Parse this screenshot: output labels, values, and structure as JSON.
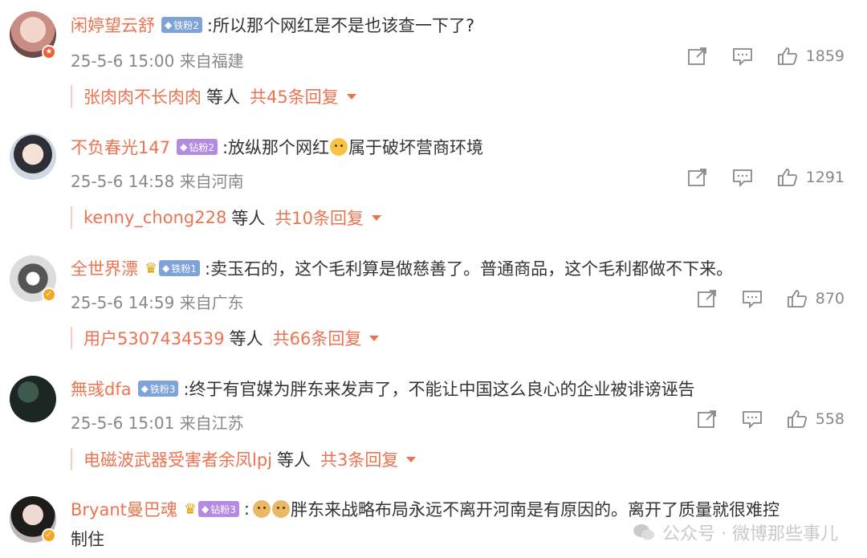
{
  "comments": [
    {
      "username": "闲婷望云舒",
      "badge": "铁粉2",
      "badge_color": "#7fa3d9",
      "text": ":所以那个网红是不是也该查一下了?",
      "text2": "",
      "time": "25-5-6 15:00",
      "location": "来自福建",
      "likes": "1859",
      "reply_user": "张肉肉不长肉肉",
      "reply_etc": "等人",
      "reply_count": "共45条回复"
    },
    {
      "username": "不负春光147",
      "badge": "钻粉2",
      "badge_color": "#b48be0",
      "text": ":放纵那个网红",
      "text2": "属于破坏营商环境",
      "time": "25-5-6 14:58",
      "location": "来自河南",
      "likes": "1291",
      "reply_user": "kenny_chong228",
      "reply_etc": "等人",
      "reply_count": "共10条回复"
    },
    {
      "username": "全世界漂",
      "badge": "铁粉1",
      "badge_color": "#7fa3d9",
      "text": ":卖玉石的，这个毛利算是做慈善了。普通商品，这个毛利都做不下来。",
      "text2": "",
      "time": "25-5-6 14:59",
      "location": "来自广东",
      "likes": "870",
      "reply_user": "用户5307434539",
      "reply_etc": "等人",
      "reply_count": "共66条回复"
    },
    {
      "username": "無彧dfa",
      "badge": "铁粉3",
      "badge_color": "#7fa3d9",
      "text": ":终于有官媒为胖东来发声了，不能让中国这么良心的企业被诽谤诬告",
      "text2": "",
      "time": "25-5-6 15:01",
      "location": "来自江苏",
      "likes": "558",
      "reply_user": "电磁波武器受害者余凤lpj",
      "reply_etc": "等人",
      "reply_count": "共3条回复"
    },
    {
      "username": "Bryant曼巴魂",
      "badge": "钻粉3",
      "badge_color": "#b48be0",
      "text": ":",
      "text2": "胖东来战略布局永远不离开河南是有原因的。离开了质量就很难控",
      "text3": "制住"
    }
  ],
  "watermark": "公众号 · 微博那些事儿",
  "icons": {
    "share": "share-icon",
    "comment": "comment-icon",
    "like": "thumbs-up-icon"
  }
}
